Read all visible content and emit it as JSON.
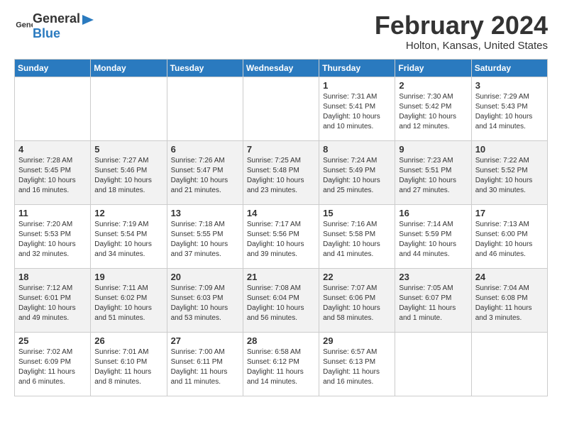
{
  "header": {
    "logo_general": "General",
    "logo_blue": "Blue",
    "month": "February 2024",
    "location": "Holton, Kansas, United States"
  },
  "weekdays": [
    "Sunday",
    "Monday",
    "Tuesday",
    "Wednesday",
    "Thursday",
    "Friday",
    "Saturday"
  ],
  "weeks": [
    [
      {
        "day": "",
        "info": ""
      },
      {
        "day": "",
        "info": ""
      },
      {
        "day": "",
        "info": ""
      },
      {
        "day": "",
        "info": ""
      },
      {
        "day": "1",
        "info": "Sunrise: 7:31 AM\nSunset: 5:41 PM\nDaylight: 10 hours\nand 10 minutes."
      },
      {
        "day": "2",
        "info": "Sunrise: 7:30 AM\nSunset: 5:42 PM\nDaylight: 10 hours\nand 12 minutes."
      },
      {
        "day": "3",
        "info": "Sunrise: 7:29 AM\nSunset: 5:43 PM\nDaylight: 10 hours\nand 14 minutes."
      }
    ],
    [
      {
        "day": "4",
        "info": "Sunrise: 7:28 AM\nSunset: 5:45 PM\nDaylight: 10 hours\nand 16 minutes."
      },
      {
        "day": "5",
        "info": "Sunrise: 7:27 AM\nSunset: 5:46 PM\nDaylight: 10 hours\nand 18 minutes."
      },
      {
        "day": "6",
        "info": "Sunrise: 7:26 AM\nSunset: 5:47 PM\nDaylight: 10 hours\nand 21 minutes."
      },
      {
        "day": "7",
        "info": "Sunrise: 7:25 AM\nSunset: 5:48 PM\nDaylight: 10 hours\nand 23 minutes."
      },
      {
        "day": "8",
        "info": "Sunrise: 7:24 AM\nSunset: 5:49 PM\nDaylight: 10 hours\nand 25 minutes."
      },
      {
        "day": "9",
        "info": "Sunrise: 7:23 AM\nSunset: 5:51 PM\nDaylight: 10 hours\nand 27 minutes."
      },
      {
        "day": "10",
        "info": "Sunrise: 7:22 AM\nSunset: 5:52 PM\nDaylight: 10 hours\nand 30 minutes."
      }
    ],
    [
      {
        "day": "11",
        "info": "Sunrise: 7:20 AM\nSunset: 5:53 PM\nDaylight: 10 hours\nand 32 minutes."
      },
      {
        "day": "12",
        "info": "Sunrise: 7:19 AM\nSunset: 5:54 PM\nDaylight: 10 hours\nand 34 minutes."
      },
      {
        "day": "13",
        "info": "Sunrise: 7:18 AM\nSunset: 5:55 PM\nDaylight: 10 hours\nand 37 minutes."
      },
      {
        "day": "14",
        "info": "Sunrise: 7:17 AM\nSunset: 5:56 PM\nDaylight: 10 hours\nand 39 minutes."
      },
      {
        "day": "15",
        "info": "Sunrise: 7:16 AM\nSunset: 5:58 PM\nDaylight: 10 hours\nand 41 minutes."
      },
      {
        "day": "16",
        "info": "Sunrise: 7:14 AM\nSunset: 5:59 PM\nDaylight: 10 hours\nand 44 minutes."
      },
      {
        "day": "17",
        "info": "Sunrise: 7:13 AM\nSunset: 6:00 PM\nDaylight: 10 hours\nand 46 minutes."
      }
    ],
    [
      {
        "day": "18",
        "info": "Sunrise: 7:12 AM\nSunset: 6:01 PM\nDaylight: 10 hours\nand 49 minutes."
      },
      {
        "day": "19",
        "info": "Sunrise: 7:11 AM\nSunset: 6:02 PM\nDaylight: 10 hours\nand 51 minutes."
      },
      {
        "day": "20",
        "info": "Sunrise: 7:09 AM\nSunset: 6:03 PM\nDaylight: 10 hours\nand 53 minutes."
      },
      {
        "day": "21",
        "info": "Sunrise: 7:08 AM\nSunset: 6:04 PM\nDaylight: 10 hours\nand 56 minutes."
      },
      {
        "day": "22",
        "info": "Sunrise: 7:07 AM\nSunset: 6:06 PM\nDaylight: 10 hours\nand 58 minutes."
      },
      {
        "day": "23",
        "info": "Sunrise: 7:05 AM\nSunset: 6:07 PM\nDaylight: 11 hours\nand 1 minute."
      },
      {
        "day": "24",
        "info": "Sunrise: 7:04 AM\nSunset: 6:08 PM\nDaylight: 11 hours\nand 3 minutes."
      }
    ],
    [
      {
        "day": "25",
        "info": "Sunrise: 7:02 AM\nSunset: 6:09 PM\nDaylight: 11 hours\nand 6 minutes."
      },
      {
        "day": "26",
        "info": "Sunrise: 7:01 AM\nSunset: 6:10 PM\nDaylight: 11 hours\nand 8 minutes."
      },
      {
        "day": "27",
        "info": "Sunrise: 7:00 AM\nSunset: 6:11 PM\nDaylight: 11 hours\nand 11 minutes."
      },
      {
        "day": "28",
        "info": "Sunrise: 6:58 AM\nSunset: 6:12 PM\nDaylight: 11 hours\nand 14 minutes."
      },
      {
        "day": "29",
        "info": "Sunrise: 6:57 AM\nSunset: 6:13 PM\nDaylight: 11 hours\nand 16 minutes."
      },
      {
        "day": "",
        "info": ""
      },
      {
        "day": "",
        "info": ""
      }
    ]
  ]
}
